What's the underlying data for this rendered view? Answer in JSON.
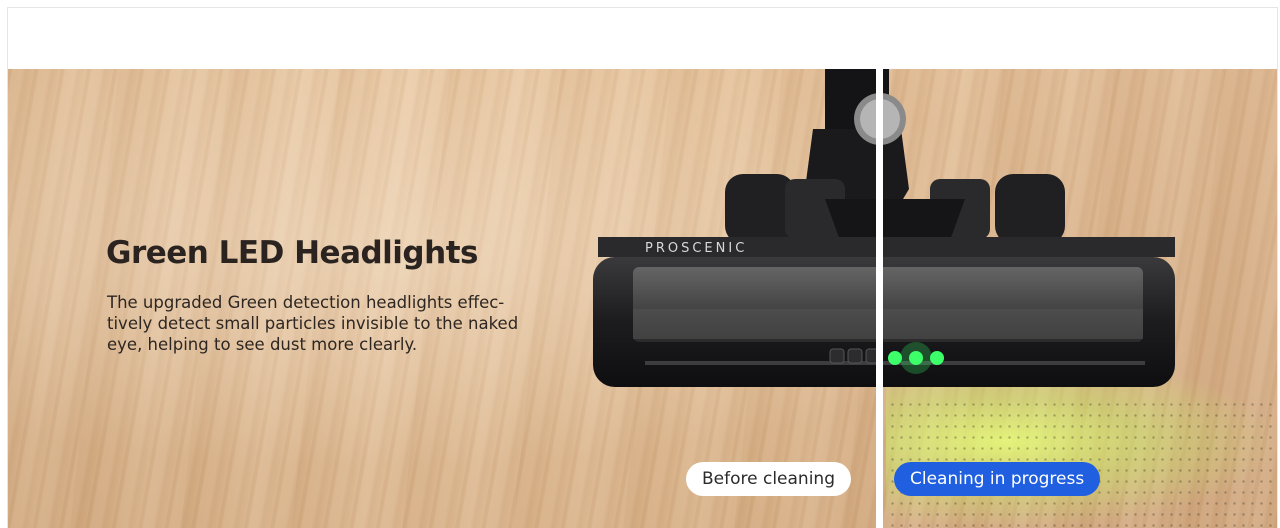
{
  "banner": {
    "title": "Green LED Headlights",
    "description": "The upgraded Green detection headlights effec-tively detect small particles invisible to the naked eye, helping to see dust more clearly.",
    "brand_text": "PROSCENIC",
    "label_before": "Before cleaning",
    "label_progress": "Cleaning in progress",
    "colors": {
      "accent": "#1f5fe0",
      "led_green": "#3cff6a",
      "title_text": "#2a2320",
      "wood": "#e2bd94"
    }
  }
}
